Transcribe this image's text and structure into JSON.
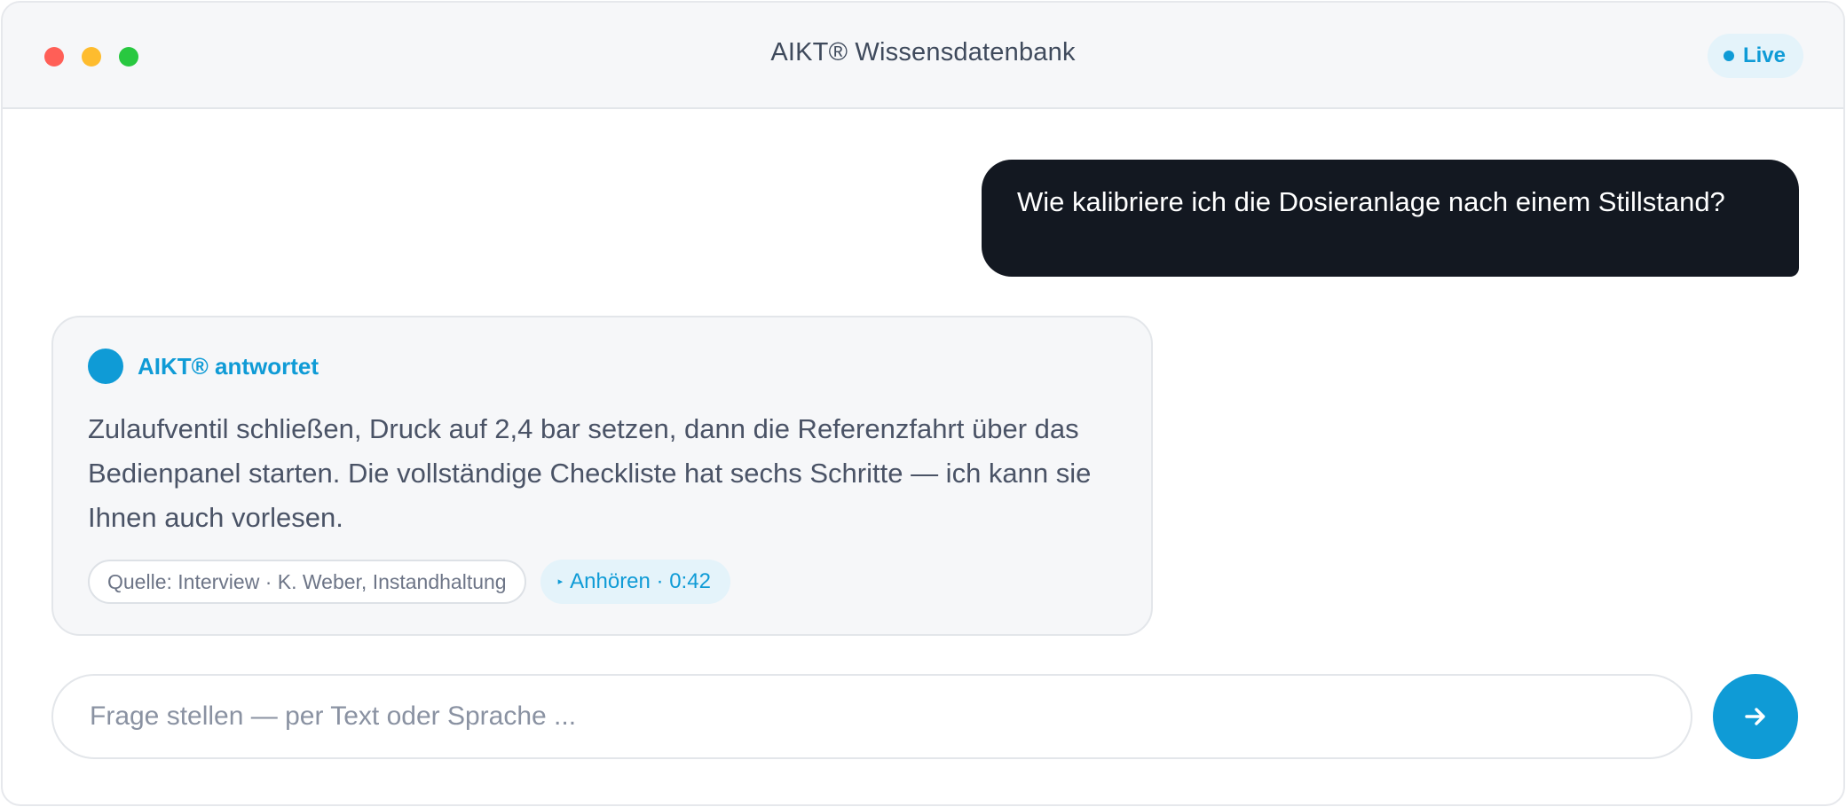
{
  "window": {
    "title": "AIKT® Wissensdatenbank",
    "status_badge": "Live"
  },
  "conversation": {
    "user_message": "Wie kalibriere ich die Dosieranlage nach einem Stillstand?",
    "assistant": {
      "name": "AIKT® antwortet",
      "text": "Zulaufventil schließen, Druck auf 2,4 bar setzen, dann die Referenzfahrt über das Bedienpanel starten. Die vollständige Checkliste hat sechs Schritte — ich kann sie Ihnen auch vorlesen.",
      "source_chip": "Quelle: Interview · K. Weber, Instandhaltung",
      "audio_chip": "Anhören · 0:42"
    }
  },
  "composer": {
    "placeholder": "Frage stellen — per Text oder Sprache ...",
    "value": ""
  },
  "icons": {
    "window_controls": [
      "close-dot",
      "minimize-dot",
      "maximize-dot"
    ],
    "status": "live-dot-icon",
    "avatar": "assistant-avatar",
    "audio": "play-icon",
    "send": "arrow-right-icon"
  },
  "colors": {
    "accent": "#0f9bd6",
    "user_bubble": "#131821",
    "card_bg": "#f6f7f9",
    "titlebar_bg": "#f6f7f9",
    "close": "#ff5f57",
    "minimize": "#febc2e",
    "maximize": "#28c840"
  }
}
